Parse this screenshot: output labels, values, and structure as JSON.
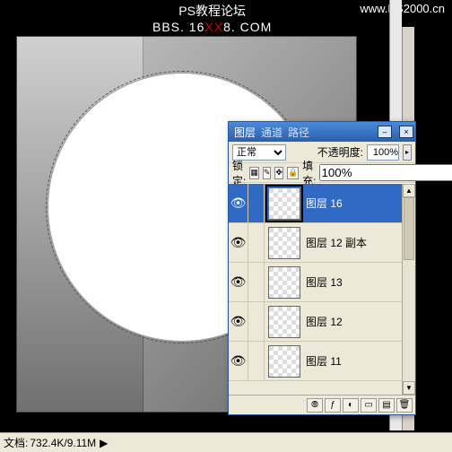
{
  "watermark": {
    "line1": "PS教程论坛",
    "line2_pre": "BBS. 16",
    "line2_mid": "XX",
    "line2_post": "8. COM",
    "url": "www.PS2000.cn"
  },
  "statusbar": {
    "label": "文档:",
    "value": "732.4K/9.11M"
  },
  "panel": {
    "tabs": {
      "layers": "图层",
      "channels": "通道",
      "paths": "路径"
    },
    "close": "×",
    "menu": "▸",
    "blend_mode": "正常",
    "opacity_label": "不透明度:",
    "opacity_value": "100%",
    "lock_label": "锁定:",
    "fill_label": "填充:",
    "fill_value": "100%",
    "lock_icons": {
      "trans": "▦",
      "pixel": "✎",
      "pos": "✥",
      "all": "🔒"
    },
    "layers": [
      {
        "name": "图层 16",
        "visible": true,
        "selected": true
      },
      {
        "name": "图层 12 副本",
        "visible": true,
        "selected": false
      },
      {
        "name": "图层 13",
        "visible": true,
        "selected": false
      },
      {
        "name": "图层 12",
        "visible": true,
        "selected": false
      },
      {
        "name": "图层 11",
        "visible": true,
        "selected": false
      }
    ],
    "eye": "👁",
    "footer_icons": {
      "link": "⦾",
      "fx": "ƒ",
      "mask": "◐",
      "folder": "▭",
      "new": "▤",
      "trash": "🗑"
    },
    "scroll": {
      "up": "▲",
      "down": "▼"
    }
  }
}
